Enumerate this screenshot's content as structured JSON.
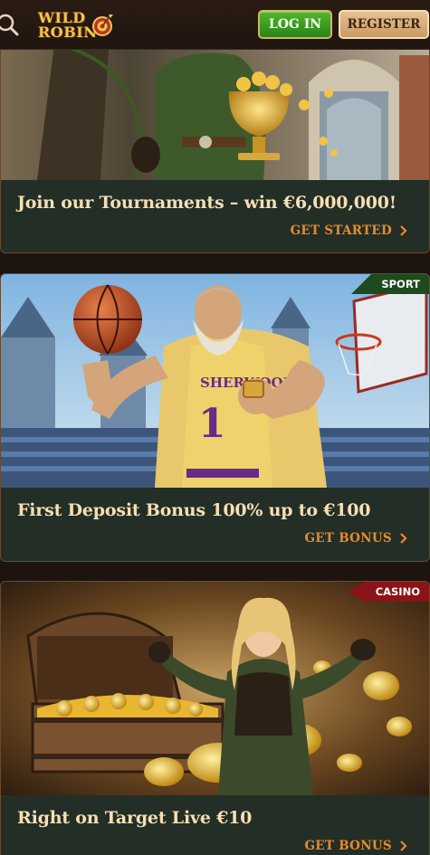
{
  "header": {
    "logo_line1": "WILD",
    "logo_line2": "ROBIN",
    "login_label": "LOG IN",
    "register_label": "REGISTER",
    "search_icon": "search-icon"
  },
  "cards": [
    {
      "title": "Join our Tournaments – win €6,000,000!",
      "cta": "GET STARTED",
      "tag": "",
      "image": "robin-with-trophy"
    },
    {
      "title": "First Deposit Bonus 100% up to €100",
      "cta": "GET BONUS",
      "tag": "SPORT",
      "tag_color": "#1e4a1e",
      "image": "basketball-player-sherwood"
    },
    {
      "title": "Right on Target Live €10",
      "cta": "GET BONUS",
      "tag": "CASINO",
      "tag_color": "#8a1418",
      "image": "treasure-chest-archer"
    }
  ],
  "colors": {
    "accent": "#e88a2c",
    "title": "#f6dfb4",
    "card_bg": "#232e26",
    "login_green": "#3a9a22",
    "register_tan": "#d9ae7c"
  }
}
